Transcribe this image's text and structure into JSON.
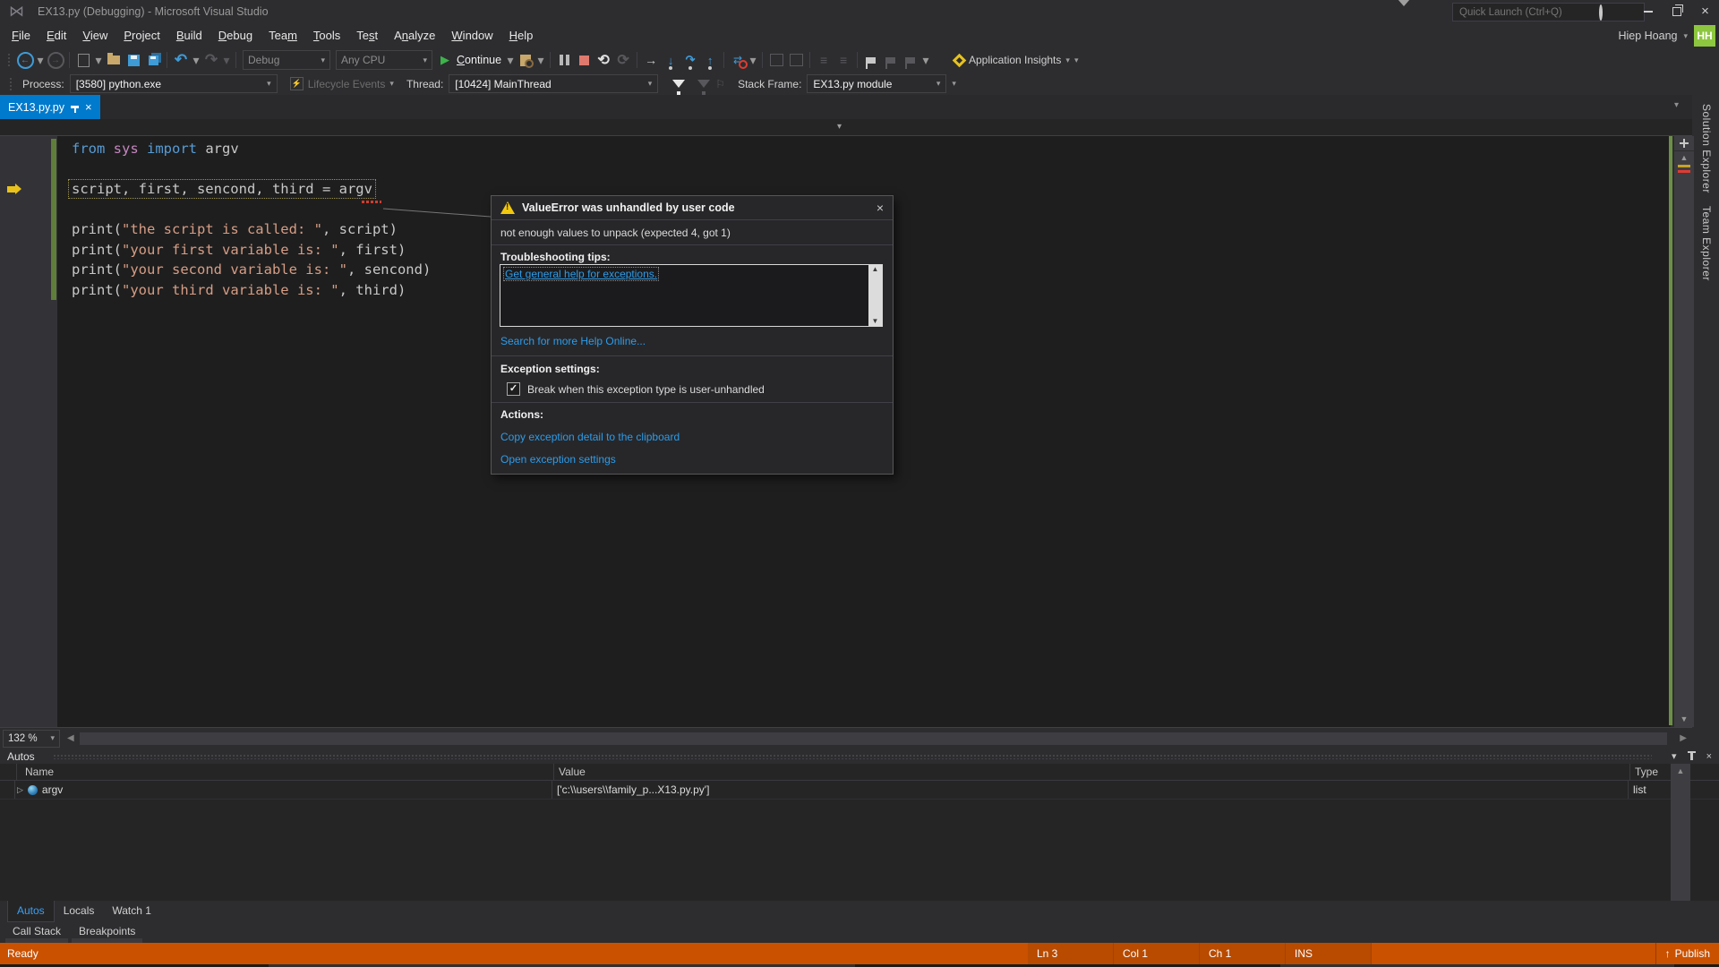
{
  "title_bar": {
    "app_title": "EX13.py (Debugging) - Microsoft Visual Studio",
    "quick_launch_placeholder": "Quick Launch (Ctrl+Q)",
    "user_name": "Hiep Hoang",
    "avatar_initials": "HH"
  },
  "menu_bar": {
    "items": [
      {
        "label": "File",
        "underline": 0
      },
      {
        "label": "Edit",
        "underline": 0
      },
      {
        "label": "View",
        "underline": 0
      },
      {
        "label": "Project",
        "underline": 0
      },
      {
        "label": "Build",
        "underline": 0
      },
      {
        "label": "Debug",
        "underline": 0
      },
      {
        "label": "Team",
        "underline": 3
      },
      {
        "label": "Tools",
        "underline": 0
      },
      {
        "label": "Test",
        "underline": 2
      },
      {
        "label": "Analyze",
        "underline": 1
      },
      {
        "label": "Window",
        "underline": 0
      },
      {
        "label": "Help",
        "underline": 0
      }
    ]
  },
  "toolbar": {
    "configuration": "Debug",
    "platform": "Any CPU",
    "continue_button": {
      "label": "Continue",
      "underline": 0
    },
    "app_insights_label": "Application Insights"
  },
  "debug_location_bar": {
    "process_label": "Process:",
    "process_value": "[3580] python.exe",
    "lifecycle_label": "Lifecycle Events",
    "thread_label": "Thread:",
    "thread_value": "[10424] MainThread",
    "stack_frame_label": "Stack Frame:",
    "stack_frame_value": "EX13.py module"
  },
  "editor": {
    "tab_title": "EX13.py.py",
    "zoom_level": "132 %",
    "current_line": 2,
    "code_lines": [
      [
        {
          "t": "from ",
          "c": "kw"
        },
        {
          "t": "sys",
          "c": "mod"
        },
        {
          "t": " ",
          "c": "pl"
        },
        {
          "t": "import",
          "c": "kw"
        },
        {
          "t": " argv",
          "c": "pl"
        }
      ],
      [],
      [
        {
          "t": "script, first, sencond, third = argv",
          "c": "pl"
        }
      ],
      [],
      [
        {
          "t": "print(",
          "c": "pl"
        },
        {
          "t": "\"the script is called: \"",
          "c": "str"
        },
        {
          "t": ", script)",
          "c": "pl"
        }
      ],
      [
        {
          "t": "print(",
          "c": "pl"
        },
        {
          "t": "\"your first variable is: \"",
          "c": "str"
        },
        {
          "t": ", first)",
          "c": "pl"
        }
      ],
      [
        {
          "t": "print(",
          "c": "pl"
        },
        {
          "t": "\"your second variable is: \"",
          "c": "str"
        },
        {
          "t": ", sencond)",
          "c": "pl"
        }
      ],
      [
        {
          "t": "print(",
          "c": "pl"
        },
        {
          "t": "\"your third variable is: \"",
          "c": "str"
        },
        {
          "t": ", third)",
          "c": "pl"
        }
      ]
    ]
  },
  "exception_dialog": {
    "title": "ValueError was unhandled by user code",
    "message": "not enough values to unpack (expected 4, got 1)",
    "troubleshooting_label": "Troubleshooting tips:",
    "tip_link": "Get general help for exceptions.",
    "search_link": "Search for more Help Online...",
    "exception_settings_label": "Exception settings:",
    "break_checkbox_label": "Break when this exception type is user-unhandled",
    "actions_label": "Actions:",
    "action_copy": "Copy exception detail to the clipboard",
    "action_open": "Open exception settings"
  },
  "autos_panel": {
    "title": "Autos",
    "columns": {
      "name": "Name",
      "value": "Value",
      "type": "Type"
    },
    "rows": [
      {
        "name": "argv",
        "value": "['c:\\\\users\\\\family_p...X13.py.py']",
        "type": "list"
      }
    ],
    "tool_tabs": [
      {
        "label": "Autos",
        "active": true
      },
      {
        "label": "Locals",
        "active": false
      },
      {
        "label": "Watch 1",
        "active": false
      }
    ],
    "tool_tabs2": [
      {
        "label": "Call Stack"
      },
      {
        "label": "Breakpoints"
      }
    ]
  },
  "side_tabs": [
    "Solution Explorer",
    "Team Explorer"
  ],
  "status_bar": {
    "status": "Ready",
    "cells": [
      "Ln 3",
      "Col 1",
      "Ch 1",
      "INS"
    ],
    "publish_label": "Publish"
  },
  "colors": {
    "accent_blue": "#007ACC",
    "status_debug_orange": "#CA5100",
    "link_blue": "#2D9CE8",
    "keyword_blue": "#569CD6",
    "module_violet": "#C586C0",
    "string_salmon": "#D69D85",
    "warning_yellow": "#F2C80F",
    "continue_green": "#3CB44A",
    "stop_red": "#E07A6E",
    "changed_line_green": "#5E7E3A",
    "avatar_green": "#8DC63F",
    "editor_bg": "#1E1E1E",
    "chrome_bg": "#2D2D30"
  }
}
